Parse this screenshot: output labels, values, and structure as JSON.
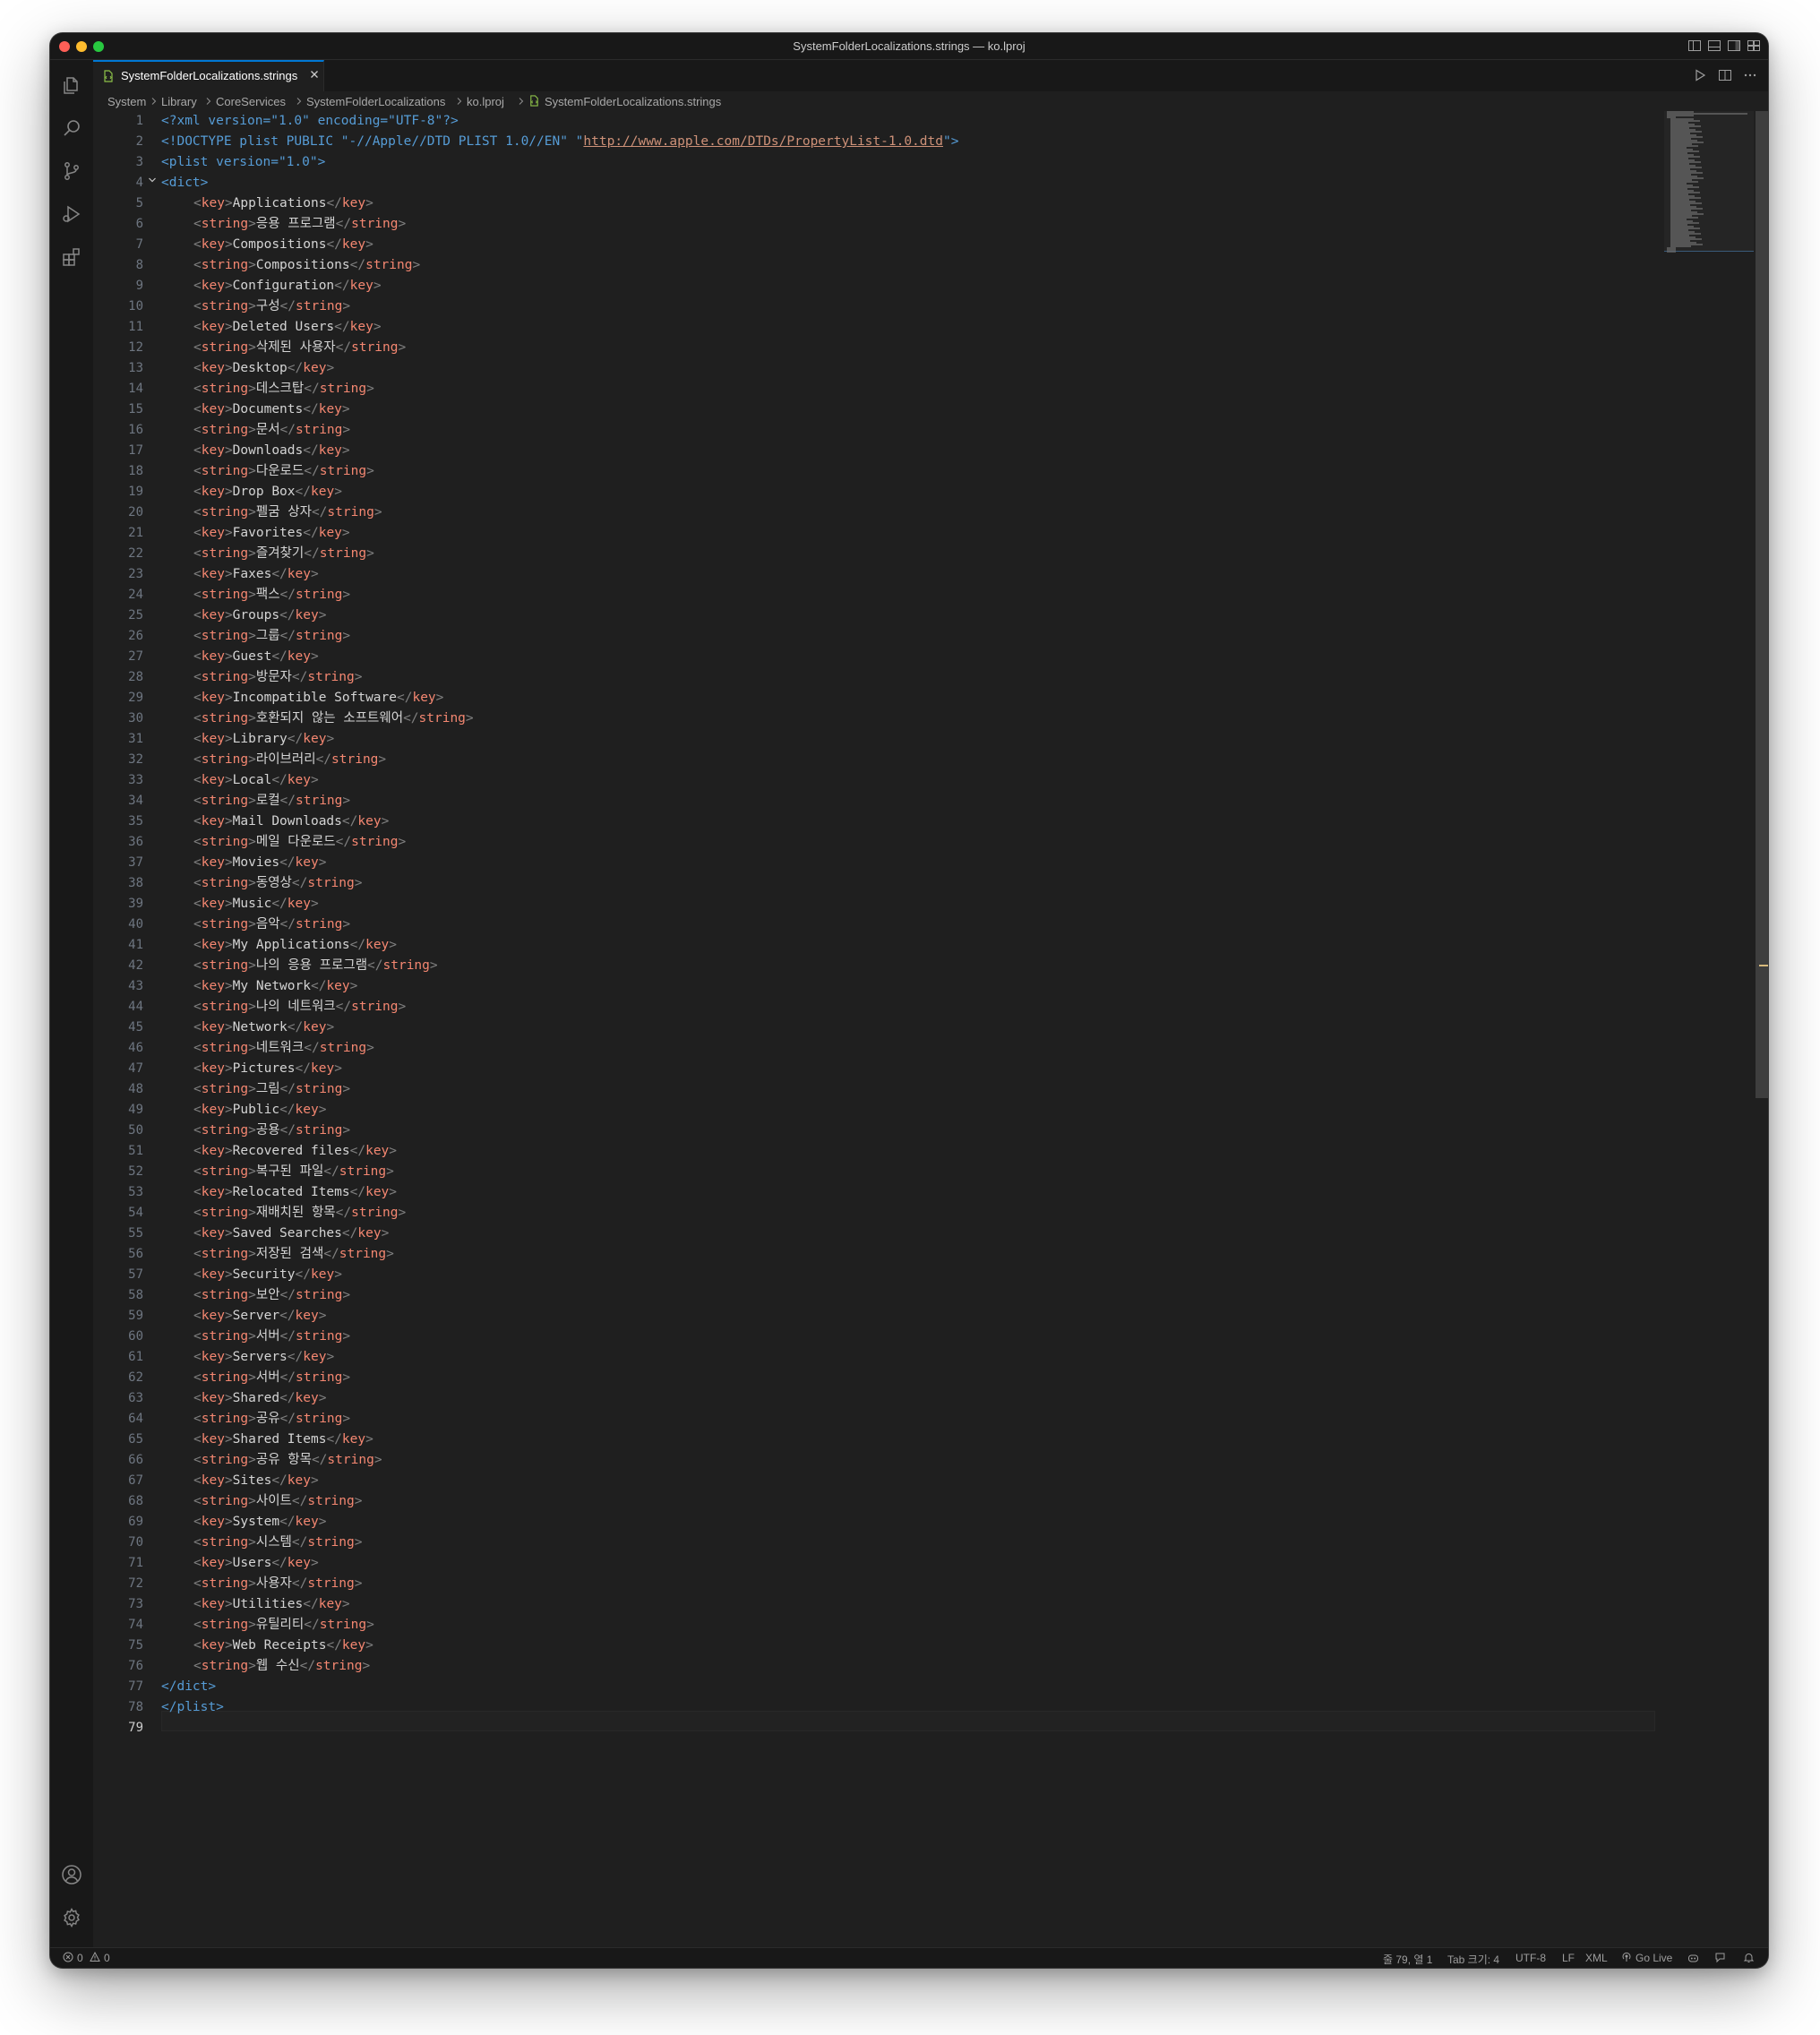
{
  "window": {
    "title": "SystemFolderLocalizations.strings — ko.lproj"
  },
  "tab": {
    "label": "SystemFolderLocalizations.strings",
    "icon": "file-icon"
  },
  "breadcrumbs": [
    "System",
    "Library",
    "CoreServices",
    "SystemFolderLocalizations",
    "ko.lproj",
    "SystemFolderLocalizations.strings"
  ],
  "activity_bar": {
    "top": [
      "explorer-icon",
      "search-icon",
      "source-control-icon",
      "run-debug-icon",
      "extensions-icon"
    ],
    "bottom": [
      "account-icon",
      "settings-gear-icon"
    ]
  },
  "editor": {
    "line_numbers": [
      "1",
      "2",
      "3",
      "4",
      "5",
      "6",
      "7",
      "8",
      "9",
      "10",
      "11",
      "12",
      "13",
      "14",
      "15",
      "16",
      "17",
      "18",
      "19",
      "20",
      "21",
      "22",
      "23",
      "24",
      "25",
      "26",
      "27",
      "28",
      "29",
      "30",
      "31",
      "32",
      "33",
      "34",
      "35",
      "36",
      "37",
      "38",
      "39",
      "40",
      "41",
      "42",
      "43",
      "44",
      "45",
      "46",
      "47",
      "48",
      "49",
      "50",
      "51",
      "52",
      "53",
      "54",
      "55",
      "56",
      "57",
      "58",
      "59",
      "60",
      "61",
      "62",
      "63",
      "64",
      "65",
      "66",
      "67",
      "68",
      "69",
      "70",
      "71",
      "72",
      "73",
      "74",
      "75",
      "76",
      "77",
      "78",
      "79"
    ],
    "active_line": 79,
    "header": {
      "xml_decl": "<?xml version=\"1.0\" encoding=\"UTF-8\"?>",
      "doctype_start": "<!DOCTYPE plist PUBLIC \"-//Apple//DTD PLIST 1.0//EN\" \"",
      "doctype_url": "http://www.apple.com/DTDs/PropertyList-1.0.dtd",
      "doctype_end": "\">",
      "plist_open": "<plist version=\"1.0\">",
      "dict_open": "<dict>",
      "dict_close": "</dict>",
      "plist_close": "</plist>"
    },
    "entries": [
      {
        "key": "Applications",
        "value": "응용 프로그램"
      },
      {
        "key": "Compositions",
        "value": "Compositions"
      },
      {
        "key": "Configuration",
        "value": "구성"
      },
      {
        "key": "Deleted Users",
        "value": "삭제된 사용자"
      },
      {
        "key": "Desktop",
        "value": "데스크탑"
      },
      {
        "key": "Documents",
        "value": "문서"
      },
      {
        "key": "Downloads",
        "value": "다운로드"
      },
      {
        "key": "Drop Box",
        "value": "펠굼 상자"
      },
      {
        "key": "Favorites",
        "value": "즐겨찾기"
      },
      {
        "key": "Faxes",
        "value": "팩스"
      },
      {
        "key": "Groups",
        "value": "그룹"
      },
      {
        "key": "Guest",
        "value": "방문자"
      },
      {
        "key": "Incompatible Software",
        "value": "호환되지 않는 소프트웨어"
      },
      {
        "key": "Library",
        "value": "라이브러리"
      },
      {
        "key": "Local",
        "value": "로컬"
      },
      {
        "key": "Mail Downloads",
        "value": "메일 다운로드"
      },
      {
        "key": "Movies",
        "value": "동영상"
      },
      {
        "key": "Music",
        "value": "음악"
      },
      {
        "key": "My Applications",
        "value": "나의 응용 프로그램"
      },
      {
        "key": "My Network",
        "value": "나의 네트워크"
      },
      {
        "key": "Network",
        "value": "네트워크"
      },
      {
        "key": "Pictures",
        "value": "그림"
      },
      {
        "key": "Public",
        "value": "공용"
      },
      {
        "key": "Recovered files",
        "value": "복구된 파일"
      },
      {
        "key": "Relocated Items",
        "value": "재배치된 항목"
      },
      {
        "key": "Saved Searches",
        "value": "저장된 검색"
      },
      {
        "key": "Security",
        "value": "보안"
      },
      {
        "key": "Server",
        "value": "서버"
      },
      {
        "key": "Servers",
        "value": "서버"
      },
      {
        "key": "Shared",
        "value": "공유"
      },
      {
        "key": "Shared Items",
        "value": "공유 항목"
      },
      {
        "key": "Sites",
        "value": "사이트"
      },
      {
        "key": "System",
        "value": "시스템"
      },
      {
        "key": "Users",
        "value": "사용자"
      },
      {
        "key": "Utilities",
        "value": "유틸리티"
      },
      {
        "key": "Web Receipts",
        "value": "웹 수신"
      }
    ]
  },
  "status_bar": {
    "errors": "0",
    "warnings": "0",
    "position": "줄 79, 열 1",
    "tab_size": "Tab 크기: 4",
    "encoding": "UTF-8",
    "eol": "LF",
    "language": "XML",
    "go_live": "Go Live"
  },
  "colors": {
    "editor_bg": "#1f1f1f",
    "tag": "#569cd6",
    "attribute": "#9cdcfe",
    "string": "#ce9178",
    "tab_accent": "#0078d4"
  }
}
